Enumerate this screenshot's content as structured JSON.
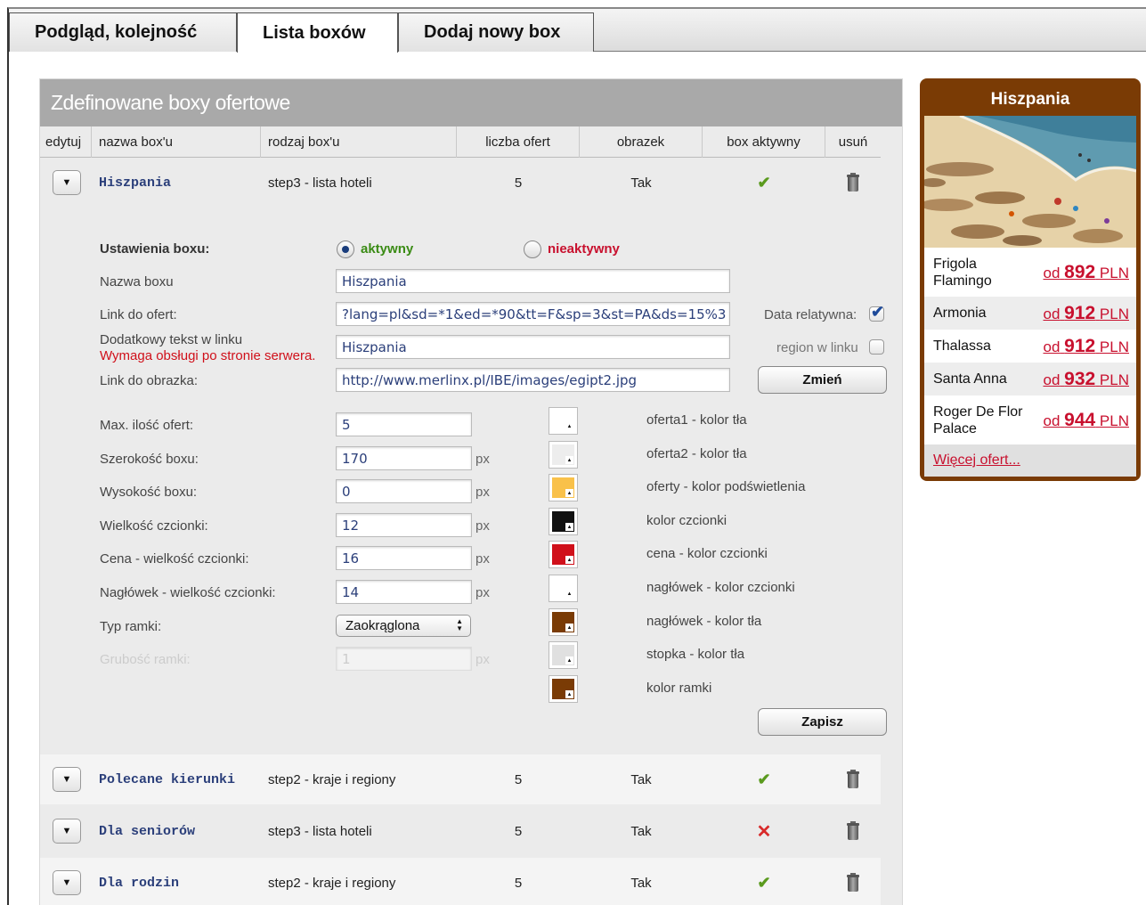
{
  "tabs": [
    {
      "label": "Podgląd, kolejność",
      "active": false
    },
    {
      "label": "Lista boxów",
      "active": true
    },
    {
      "label": "Dodaj nowy box",
      "active": false
    }
  ],
  "panel": {
    "title": "Zdefinowane boxy ofertowe",
    "columns": [
      "edytuj",
      "nazwa box'u",
      "rodzaj box'u",
      "liczba ofert",
      "obrazek",
      "box aktywny",
      "usuń"
    ]
  },
  "rows": [
    {
      "name": "Hiszpania",
      "type": "step3 - lista hoteli",
      "count": "5",
      "image": "Tak",
      "active": "yes"
    },
    {
      "name": "Polecane kierunki",
      "type": "step2 - kraje i regiony",
      "count": "5",
      "image": "Tak",
      "active": "yes"
    },
    {
      "name": "Dla seniorów",
      "type": "step3 - lista hoteli",
      "count": "5",
      "image": "Tak",
      "active": "no"
    },
    {
      "name": "Dla rodzin",
      "type": "step2 - kraje i regiony",
      "count": "5",
      "image": "Tak",
      "active": "yes"
    }
  ],
  "settings": {
    "header": "Ustawienia boxu:",
    "radio_active": "aktywny",
    "radio_inactive": "nieaktywny",
    "name_label": "Nazwa boxu",
    "name_value": "Hiszpania",
    "link_label": "Link do ofert:",
    "link_value": "?lang=pl&sd=*1&ed=*90&tt=F&sp=3&st=PA&ds=15%3",
    "relative_label": "Data relatywna:",
    "extra_label": "Dodatkowy tekst w linku",
    "extra_warning": "Wymaga obsługi po stronie serwera.",
    "extra_value": "Hiszpania",
    "region_label": "region w linku",
    "image_label": "Link do obrazka:",
    "image_value": "http://www.merlinx.pl/IBE/images/egipt2.jpg",
    "change_button": "Zmień",
    "save_button": "Zapisz",
    "px": "px",
    "fields": [
      {
        "label": "Max. ilość ofert:",
        "value": "5",
        "unit": ""
      },
      {
        "label": "Szerokość boxu:",
        "value": "170",
        "unit": "px"
      },
      {
        "label": "Wysokość boxu:",
        "value": "0",
        "unit": "px"
      },
      {
        "label": "Wielkość czcionki:",
        "value": "12",
        "unit": "px"
      },
      {
        "label": "Cena - wielkość czcionki:",
        "value": "16",
        "unit": "px"
      },
      {
        "label": "Nagłówek - wielkość czcionki:",
        "value": "14",
        "unit": "px"
      }
    ],
    "frame_type_label": "Typ ramki:",
    "frame_type_value": "Zaokrąglona",
    "frame_width_label": "Grubość ramki:",
    "frame_width_value": "1",
    "colors": [
      {
        "label": "oferta1 - kolor tła",
        "color": "#ffffff"
      },
      {
        "label": "oferta2 - kolor tła",
        "color": "#ededed"
      },
      {
        "label": "oferty - kolor podświetlenia",
        "color": "#f9c14a"
      },
      {
        "label": "kolor czcionki",
        "color": "#111111"
      },
      {
        "label": "cena - kolor czcionki",
        "color": "#d0101a"
      },
      {
        "label": "nagłówek - kolor czcionki",
        "color": "#ffffff"
      },
      {
        "label": "nagłówek - kolor tła",
        "color": "#7a3b05"
      },
      {
        "label": "stopka - kolor tła",
        "color": "#e0e0e0"
      },
      {
        "label": "kolor ramki",
        "color": "#7a3b05"
      }
    ]
  },
  "preview": {
    "title": "Hiszpania",
    "offers": [
      {
        "name": "Frigola Flamingo",
        "prefix": "od",
        "price": "892",
        "currency": "PLN"
      },
      {
        "name": "Armonia",
        "prefix": "od",
        "price": "912",
        "currency": "PLN"
      },
      {
        "name": "Thalassa",
        "prefix": "od",
        "price": "912",
        "currency": "PLN"
      },
      {
        "name": "Santa Anna",
        "prefix": "od",
        "price": "932",
        "currency": "PLN"
      },
      {
        "name": "Roger De Flor Palace",
        "prefix": "od",
        "price": "944",
        "currency": "PLN"
      }
    ],
    "more_link": "Więcej ofert..."
  }
}
